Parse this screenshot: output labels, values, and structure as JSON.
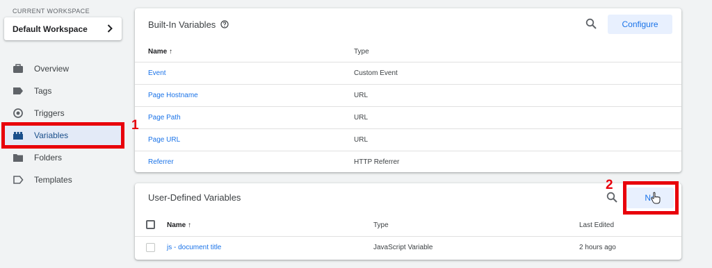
{
  "sidebar": {
    "workspace_label": "CURRENT WORKSPACE",
    "workspace_name": "Default Workspace",
    "items": [
      {
        "label": "Overview",
        "icon": "briefcase-icon"
      },
      {
        "label": "Tags",
        "icon": "tag-icon"
      },
      {
        "label": "Triggers",
        "icon": "trigger-icon"
      },
      {
        "label": "Variables",
        "icon": "blocks-icon",
        "active": true
      },
      {
        "label": "Folders",
        "icon": "folder-icon"
      },
      {
        "label": "Templates",
        "icon": "template-icon"
      }
    ]
  },
  "builtin": {
    "title": "Built-In Variables",
    "configure_label": "Configure",
    "col_name": "Name",
    "col_type": "Type",
    "rows": [
      {
        "name": "Event",
        "type": "Custom Event"
      },
      {
        "name": "Page Hostname",
        "type": "URL"
      },
      {
        "name": "Page Path",
        "type": "URL"
      },
      {
        "name": "Page URL",
        "type": "URL"
      },
      {
        "name": "Referrer",
        "type": "HTTP Referrer"
      }
    ]
  },
  "userdefined": {
    "title": "User-Defined Variables",
    "new_label": "Ne",
    "col_name": "Name",
    "col_type": "Type",
    "col_edited": "Last Edited",
    "rows": [
      {
        "name": "js - document title",
        "type": "JavaScript Variable",
        "edited": "2 hours ago"
      }
    ]
  },
  "annotations": {
    "step1": "1",
    "step2": "2",
    "color": "#e8000b"
  },
  "colors": {
    "accent": "#1a73e8",
    "button_bg": "#e8f0fe",
    "active_nav_bg": "#e3eaf7"
  }
}
